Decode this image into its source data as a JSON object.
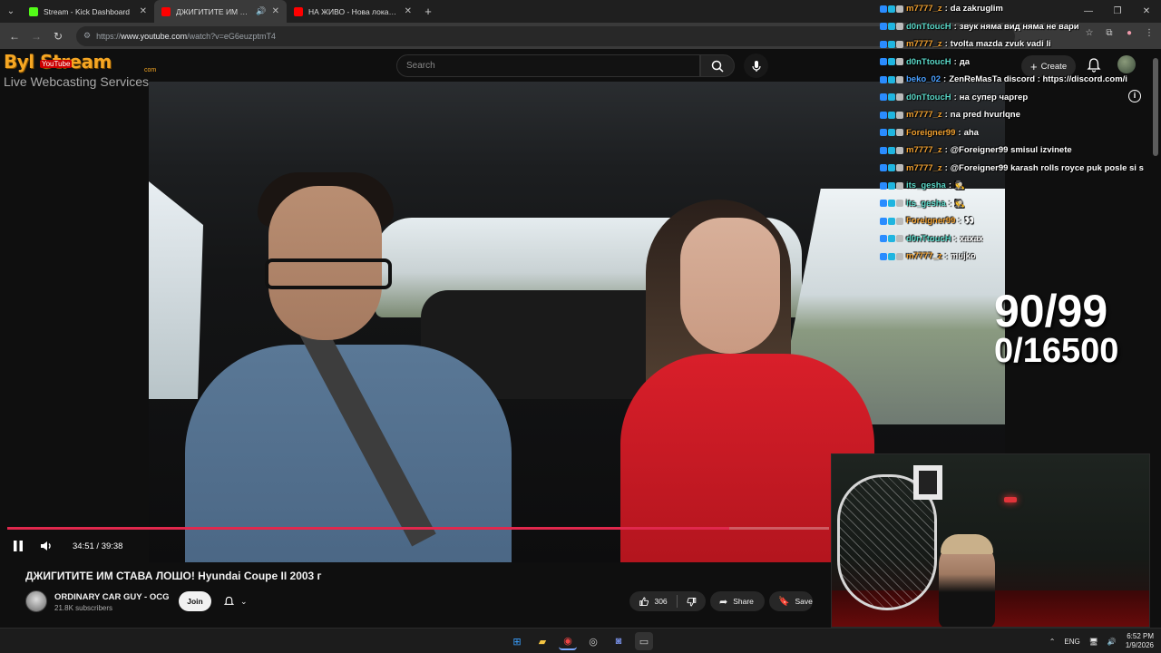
{
  "browser": {
    "tabs": [
      {
        "title": "Stream - Kick Dashboard",
        "active": false,
        "favicon_color": "#53fc18"
      },
      {
        "title": "ДЖИГИТИТЕ ИМ СТАВА ЛОШ",
        "active": true,
        "favicon_color": "#ff0000",
        "audio": true
      },
      {
        "title": "НА ЖИВО - Нова локация в Г",
        "active": false,
        "favicon_color": "#ff0000"
      }
    ],
    "new_tab": "+",
    "url_scheme": "https://",
    "url_host": "www.youtube.com",
    "url_path": "/watch?v=eG6euzptmT4"
  },
  "youtube": {
    "search_placeholder": "Search",
    "create_label": "Create",
    "video": {
      "title": "ДЖИГИТИТЕ ИМ СТАВА ЛОШО! Hyundai Coupe II 2003 г",
      "time_display": "34:51 / 39:38",
      "progress_fraction": 0.879
    },
    "channel": {
      "name": "ORDINARY CAR GUY - OCG",
      "subscribers": "21.8K subscribers",
      "join_label": "Join"
    },
    "actions": {
      "like_count": "306",
      "share_label": "Share",
      "save_label": "Save"
    }
  },
  "logo": {
    "brand": "Byl  Stream",
    "brand_sub": "YouTube",
    "com": "com",
    "tagline": "Live Webcasting Services"
  },
  "overlay_counter": {
    "line1": "90/99",
    "line2": "0/16500"
  },
  "chat": [
    {
      "user": "m7777_z",
      "user_color": "#f0a030",
      "message": "da zakruglim"
    },
    {
      "user": "d0nTtoucH",
      "user_color": "#5ad8c8",
      "message": "звук няма вид няма не вари"
    },
    {
      "user": "m7777_z",
      "user_color": "#f0a030",
      "message": "tvolta mazda zvuk vadi li"
    },
    {
      "user": "d0nTtoucH",
      "user_color": "#5ad8c8",
      "message": "да"
    },
    {
      "user": "beko_02",
      "user_color": "#4aa0ff",
      "message": "ZenReMasTa discord : https://discord.com/i"
    },
    {
      "user": "d0nTtoucH",
      "user_color": "#5ad8c8",
      "message": "на супер чаргер"
    },
    {
      "user": "m7777_z",
      "user_color": "#f0a030",
      "message": "na pred hvurlqne"
    },
    {
      "user": "Foreigner99",
      "user_color": "#f0a030",
      "message": "aha"
    },
    {
      "user": "m7777_z",
      "user_color": "#f0a030",
      "message": "@Foreigner99 smisul izvinete"
    },
    {
      "user": "m7777_z",
      "user_color": "#f0a030",
      "message": "@Foreigner99 karash rolls royce puk posle si s"
    },
    {
      "user": "its_gesha",
      "user_color": "#5ad8c8",
      "message": "🕵️"
    },
    {
      "user": "its_gesha",
      "user_color": "#5ad8c8",
      "message": "🕵️"
    },
    {
      "user": "Foreigner99",
      "user_color": "#f0a030",
      "message": "👀"
    },
    {
      "user": "d0nTtoucH",
      "user_color": "#5ad8c8",
      "message": "хахах"
    },
    {
      "user": "m7777_z",
      "user_color": "#f0a030",
      "message": "mujko"
    }
  ],
  "taskbar": {
    "language": "ENG",
    "time": "6:52 PM",
    "date": "1/9/2026"
  }
}
